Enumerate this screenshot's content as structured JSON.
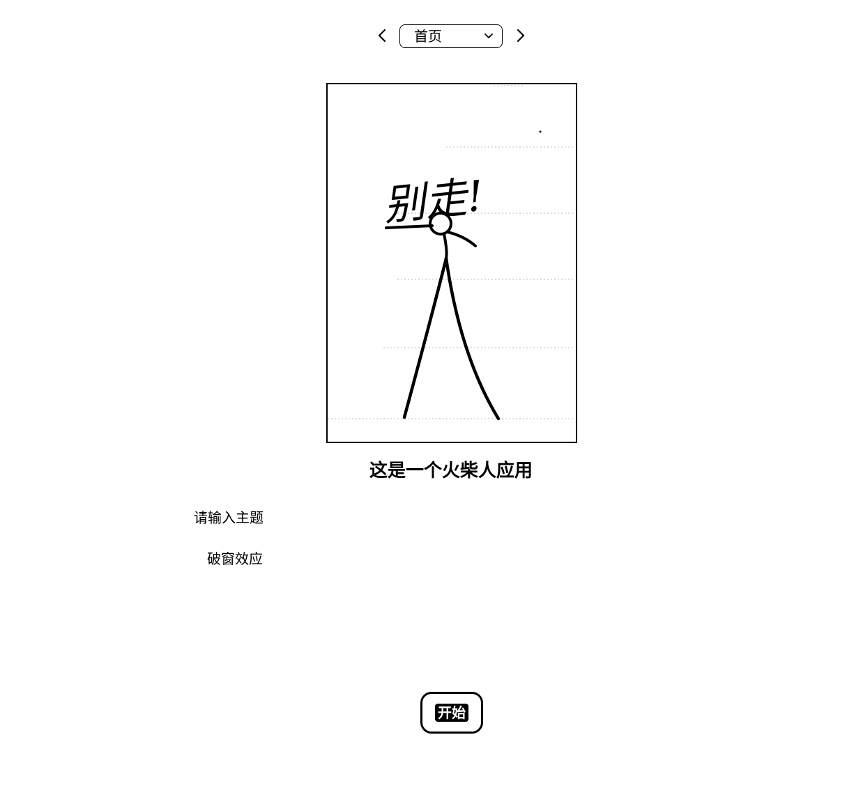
{
  "nav": {
    "prev_icon": "chevron-left-icon",
    "next_icon": "chevron-right-icon",
    "page_select": {
      "selected": "首页",
      "icon": "chevron-down-icon"
    }
  },
  "illustration": {
    "handwritten_text": "别走!"
  },
  "main": {
    "title": "这是一个火柴人应用"
  },
  "form": {
    "topic_label": "请输入主题",
    "topic_value": "破窗效应"
  },
  "actions": {
    "start_label": "开始"
  },
  "colors": {
    "foreground": "#000000",
    "background": "#ffffff"
  }
}
